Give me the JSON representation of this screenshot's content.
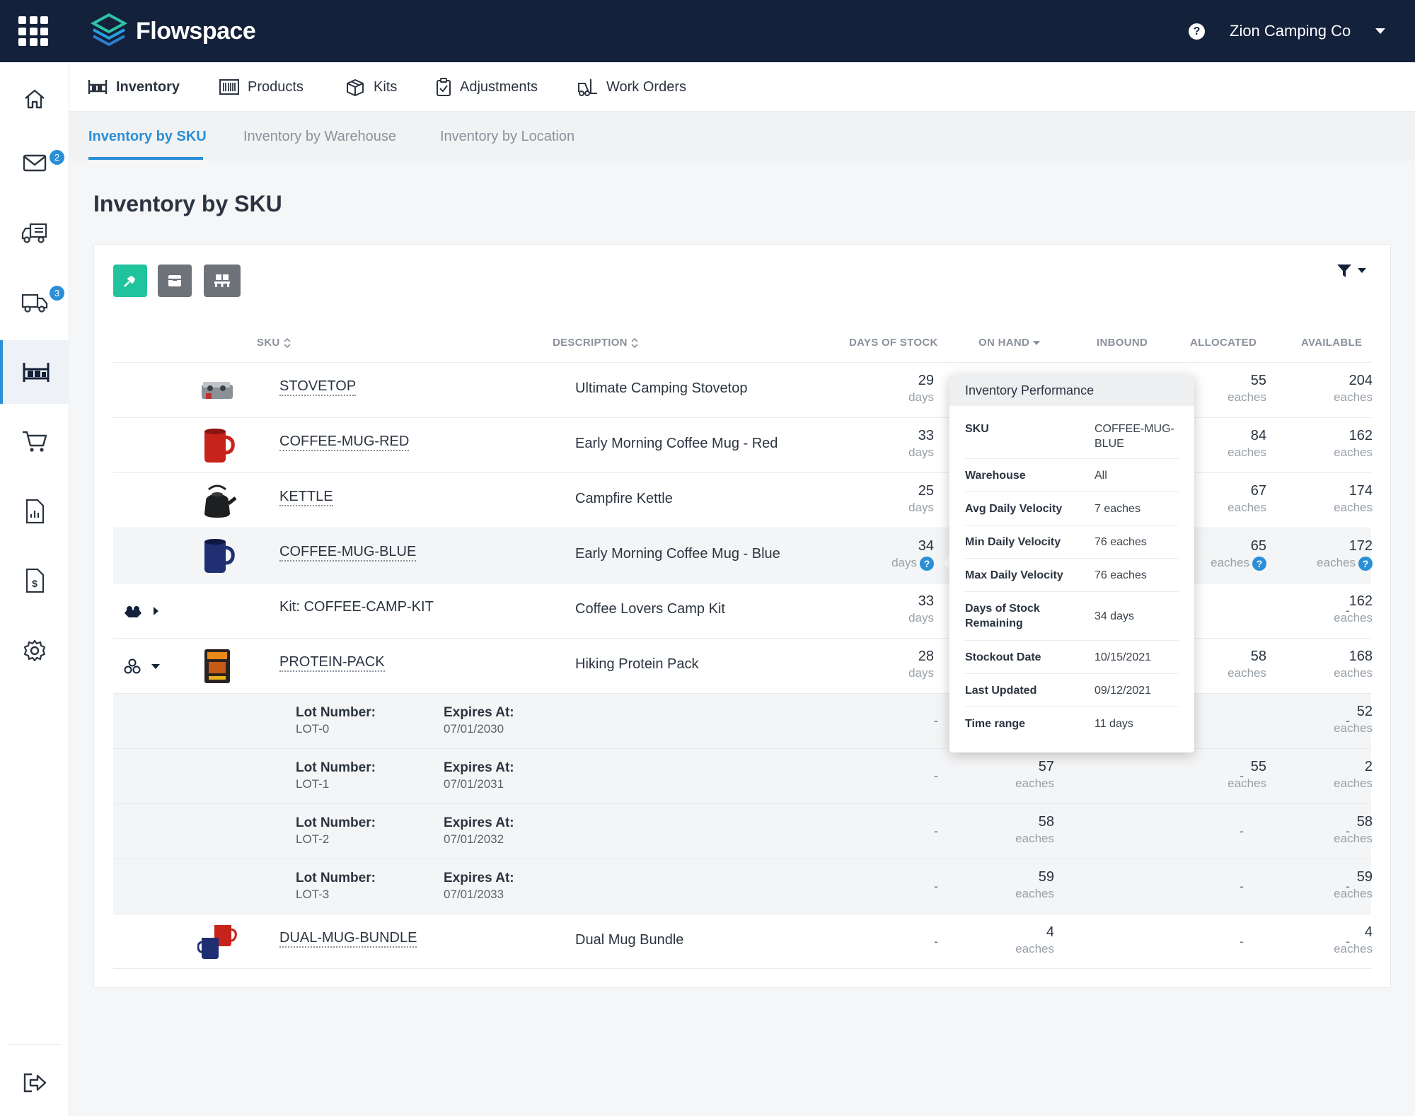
{
  "app": {
    "name": "Flowspace",
    "account": "Zion Camping Co"
  },
  "sidebar": {
    "badges": {
      "inbox": "2",
      "shipments": "3"
    }
  },
  "nav": {
    "primary": [
      {
        "label": "Inventory",
        "icon": "warehouse-icon"
      },
      {
        "label": "Products",
        "icon": "barcode-icon"
      },
      {
        "label": "Kits",
        "icon": "box-icon"
      },
      {
        "label": "Adjustments",
        "icon": "clipboard-icon"
      },
      {
        "label": "Work Orders",
        "icon": "forklift-icon"
      }
    ],
    "secondary": [
      "Inventory by SKU",
      "Inventory by Warehouse",
      "Inventory by Location"
    ]
  },
  "page": {
    "title": "Inventory by SKU"
  },
  "colors": {
    "accent": "#2a8fd6",
    "topbar": "#14213a",
    "tool_primary": "#21c39d",
    "tool_secondary": "#6e7379"
  },
  "table": {
    "headers": {
      "sku": "SKU",
      "description": "DESCRIPTION",
      "days_of_stock": "DAYS OF STOCK",
      "on_hand": "ON HAND",
      "inbound": "INBOUND",
      "allocated": "ALLOCATED",
      "available": "AVAILABLE"
    },
    "rows": [
      {
        "sku": "STOVETOP",
        "description": "Ultimate Camping Stovetop",
        "days": "29",
        "days_unit": "days",
        "allocated": "55",
        "allocated_unit": "eaches",
        "available": "204",
        "available_unit": "eaches"
      },
      {
        "sku": "COFFEE-MUG-RED",
        "description": "Early Morning Coffee Mug - Red",
        "days": "33",
        "days_unit": "days",
        "allocated": "84",
        "allocated_unit": "eaches",
        "available": "162",
        "available_unit": "eaches"
      },
      {
        "sku": "KETTLE",
        "description": "Campfire Kettle",
        "days": "25",
        "days_unit": "days",
        "allocated": "67",
        "allocated_unit": "eaches",
        "available": "174",
        "available_unit": "eaches"
      },
      {
        "sku": "COFFEE-MUG-BLUE",
        "description": "Early Morning Coffee Mug - Blue",
        "days": "34",
        "days_unit": "days",
        "allocated": "65",
        "allocated_unit": "eaches",
        "available": "172",
        "available_unit": "eaches"
      },
      {
        "sku": "Kit: COFFEE-CAMP-KIT",
        "description": "Coffee Lovers Camp Kit",
        "days": "33",
        "days_unit": "days",
        "allocated": "-",
        "available": "162",
        "available_unit": "eaches"
      },
      {
        "sku": "PROTEIN-PACK",
        "description": "Hiking Protein Pack",
        "days": "28",
        "days_unit": "days",
        "allocated": "58",
        "allocated_unit": "eaches",
        "available": "168",
        "available_unit": "eaches"
      }
    ],
    "lots": [
      {
        "lot_label": "Lot Number:",
        "lot": "LOT-0",
        "exp_label": "Expires At:",
        "expires": "07/01/2030",
        "days": "-",
        "allocated": "-",
        "available": "52",
        "available_unit": "eaches"
      },
      {
        "lot_label": "Lot Number:",
        "lot": "LOT-1",
        "exp_label": "Expires At:",
        "expires": "07/01/2031",
        "days": "-",
        "on_hand": "57",
        "on_hand_unit": "eaches",
        "inbound": "-",
        "allocated": "55",
        "allocated_unit": "eaches",
        "available": "2",
        "available_unit": "eaches"
      },
      {
        "lot_label": "Lot Number:",
        "lot": "LOT-2",
        "exp_label": "Expires At:",
        "expires": "07/01/2032",
        "days": "-",
        "on_hand": "58",
        "on_hand_unit": "eaches",
        "inbound": "-",
        "allocated": "-",
        "available": "58",
        "available_unit": "eaches"
      },
      {
        "lot_label": "Lot Number:",
        "lot": "LOT-3",
        "exp_label": "Expires At:",
        "expires": "07/01/2033",
        "days": "-",
        "on_hand": "59",
        "on_hand_unit": "eaches",
        "inbound": "-",
        "allocated": "-",
        "available": "59",
        "available_unit": "eaches"
      }
    ],
    "bundle": {
      "sku": "DUAL-MUG-BUNDLE",
      "description": "Dual Mug Bundle",
      "days": "-",
      "on_hand": "4",
      "on_hand_unit": "eaches",
      "inbound": "-",
      "allocated": "-",
      "available": "4",
      "available_unit": "eaches"
    }
  },
  "tooltip": {
    "title": "Inventory Performance",
    "rows": [
      {
        "key": "SKU",
        "value": "COFFEE-MUG-BLUE"
      },
      {
        "key": "Warehouse",
        "value": "All"
      },
      {
        "key": "Avg Daily Velocity",
        "value": "7 eaches"
      },
      {
        "key": "Min Daily Velocity",
        "value": "76 eaches"
      },
      {
        "key": "Max Daily Velocity",
        "value": "76 eaches"
      },
      {
        "key": "Days of Stock Remaining",
        "value": "34 days"
      },
      {
        "key": "Stockout Date",
        "value": "10/15/2021"
      },
      {
        "key": "Last Updated",
        "value": "09/12/2021"
      },
      {
        "key": "Time range",
        "value": "11 days"
      }
    ]
  }
}
